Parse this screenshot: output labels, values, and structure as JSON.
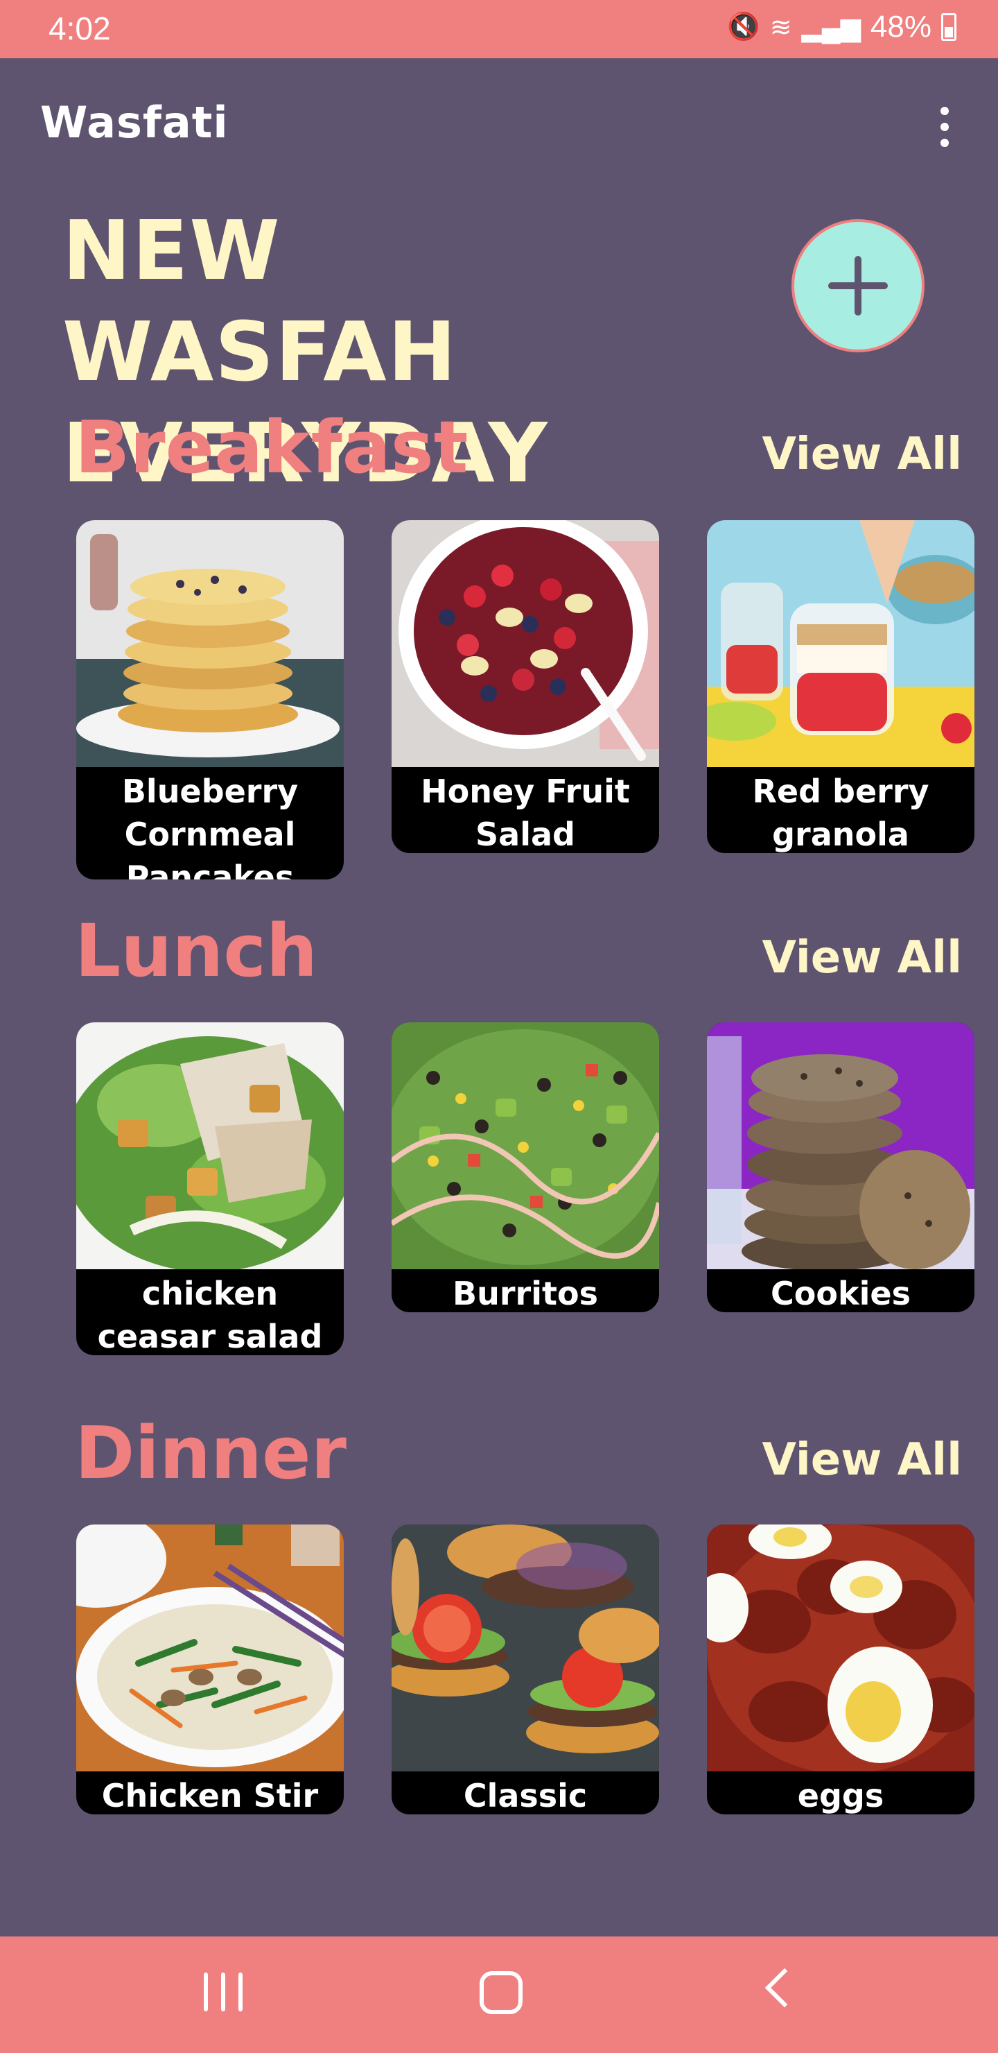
{
  "status": {
    "time": "4:02",
    "battery": "48%"
  },
  "app": {
    "title": "Wasfati",
    "hero_line1": "NEW WASFAH",
    "hero_line2": "EVERYDAY"
  },
  "sections": [
    {
      "title": "Breakfast",
      "view_all": "View All",
      "items": [
        {
          "name": "Blueberry Cornmeal Pancakes"
        },
        {
          "name": "Honey Fruit Salad"
        },
        {
          "name": "Red berry granola yogurt"
        }
      ]
    },
    {
      "title": "Lunch",
      "view_all": "View All",
      "items": [
        {
          "name": "chicken ceasar salad"
        },
        {
          "name": "Burritos Bowls"
        },
        {
          "name": "Cookies"
        }
      ]
    },
    {
      "title": "Dinner",
      "view_all": "View All",
      "items": [
        {
          "name": "Chicken Stir Fry"
        },
        {
          "name": "Classic Burger"
        },
        {
          "name": "eggs"
        }
      ]
    }
  ],
  "colors": {
    "background": "#5e5470",
    "accent": "#f07f80",
    "cream": "#fff6c7",
    "fab": "#a8ede2"
  }
}
